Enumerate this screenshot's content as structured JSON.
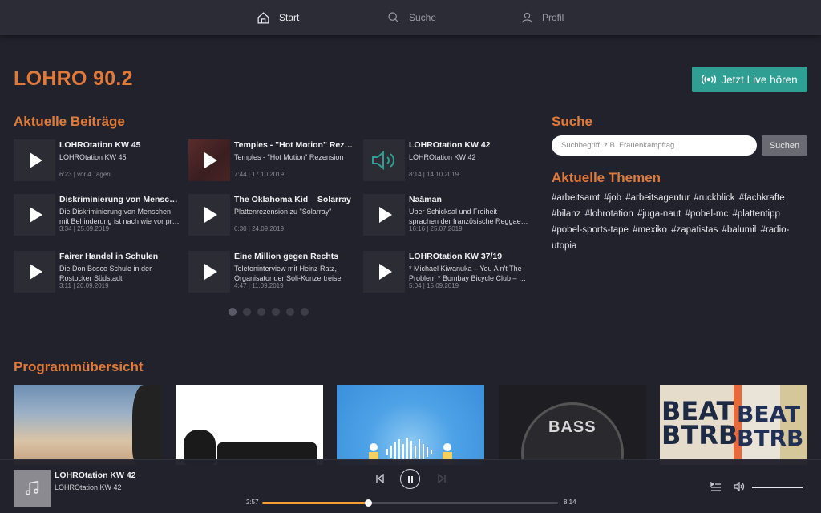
{
  "nav": [
    {
      "label": "Start",
      "icon": "home-icon",
      "active": true
    },
    {
      "label": "Suche",
      "icon": "search-icon",
      "active": false
    },
    {
      "label": "Profil",
      "icon": "user-icon",
      "active": false
    }
  ],
  "brand": "LOHRO 90.2",
  "live_button": {
    "label": "Jetzt Live hören",
    "icon": "broadcast-icon",
    "color": "#2f9e93"
  },
  "recent": {
    "title": "Aktuelle Beiträge",
    "items": [
      {
        "title": "LOHROtation KW 45",
        "desc": [
          "LOHROtation KW 45"
        ],
        "meta": "6:23 | vor 4 Tagen",
        "state": "play"
      },
      {
        "title": "Temples - \"Hot Motion\" Rezension",
        "desc": [
          "Temples - \"Hot Motion\" Rezension"
        ],
        "meta": "7:44 | 17.10.2019",
        "state": "play-image"
      },
      {
        "title": "LOHROtation KW 42",
        "desc": [
          "LOHROtation KW 42"
        ],
        "meta": "8:14 | 14.10.2019",
        "state": "playing"
      },
      {
        "title": "Diskriminierung von Menschen mit Behinderung",
        "desc": [
          "Die Diskriminierung von Menschen",
          "mit Behinderung ist nach wie vor präsent"
        ],
        "meta": "3:34 | 25.09.2019",
        "state": "play"
      },
      {
        "title": "The Oklahoma Kid – Solarray",
        "desc": [
          "Plattenrezension zu \"Solarray\""
        ],
        "meta": "6:30 | 24.09.2019",
        "state": "play"
      },
      {
        "title": "Naâman",
        "desc": [
          "Über Schicksal und Freiheit",
          "sprachen der französische Reggae-Künstler"
        ],
        "meta": "16:16 | 25.07.2019",
        "state": "play"
      },
      {
        "title": "Fairer Handel in Schulen",
        "desc": [
          "Die Don Bosco Schule in der",
          "Rostocker Südstadt"
        ],
        "meta": "3:11 | 20.09.2019",
        "state": "play"
      },
      {
        "title": "Eine Million gegen Rechts",
        "desc": [
          "Telefoninterview mit Heinz Ratz,",
          "Organisator der Soli-Konzertreise"
        ],
        "meta": "4:47 | 11.09.2019",
        "state": "play"
      },
      {
        "title": "LOHROtation KW 37/19",
        "desc": [
          "* Michael Kiwanuka – You Ain't The",
          "Problem * Bombay Bicycle Club – Eat"
        ],
        "meta": "5:04 | 15.09.2019",
        "state": "play"
      }
    ],
    "pages": 6,
    "current_page": 1
  },
  "search": {
    "title": "Suche",
    "placeholder": "Suchbegriff, z.B. Frauenkampftag",
    "value": "",
    "button": "Suchen"
  },
  "topics": {
    "title": "Aktuelle Themen",
    "tags": [
      "#arbeitsamt",
      "#job",
      "#arbeitsagentur",
      "#ruckblick",
      "#fachkrafte",
      "#bilanz",
      "#lohrotation",
      "#juga-naut",
      "#pobel-mc",
      "#plattentipp",
      "#pobel-sports-tape",
      "#mexiko",
      "#zapatistas",
      "#balumil",
      "#radio-utopia"
    ]
  },
  "program": {
    "title": "Programmübersicht",
    "cards": [
      "sunset-portrait",
      "podcast-mic-logo",
      "blue-soundwave",
      "bass-vinyl",
      "beat-btrb"
    ],
    "card_texts": {
      "bass": "BASS",
      "beat": "BEAT BTRB"
    }
  },
  "player": {
    "title": "LOHROtation KW 42",
    "subtitle": "LOHROtation KW 42",
    "elapsed": "2:57",
    "duration": "8:14",
    "progress": 0.358,
    "volume": 1.0,
    "accent": "#f0a030"
  },
  "colors": {
    "accent": "#e07a3a",
    "live": "#2f9e93",
    "bg": "#22222c"
  }
}
